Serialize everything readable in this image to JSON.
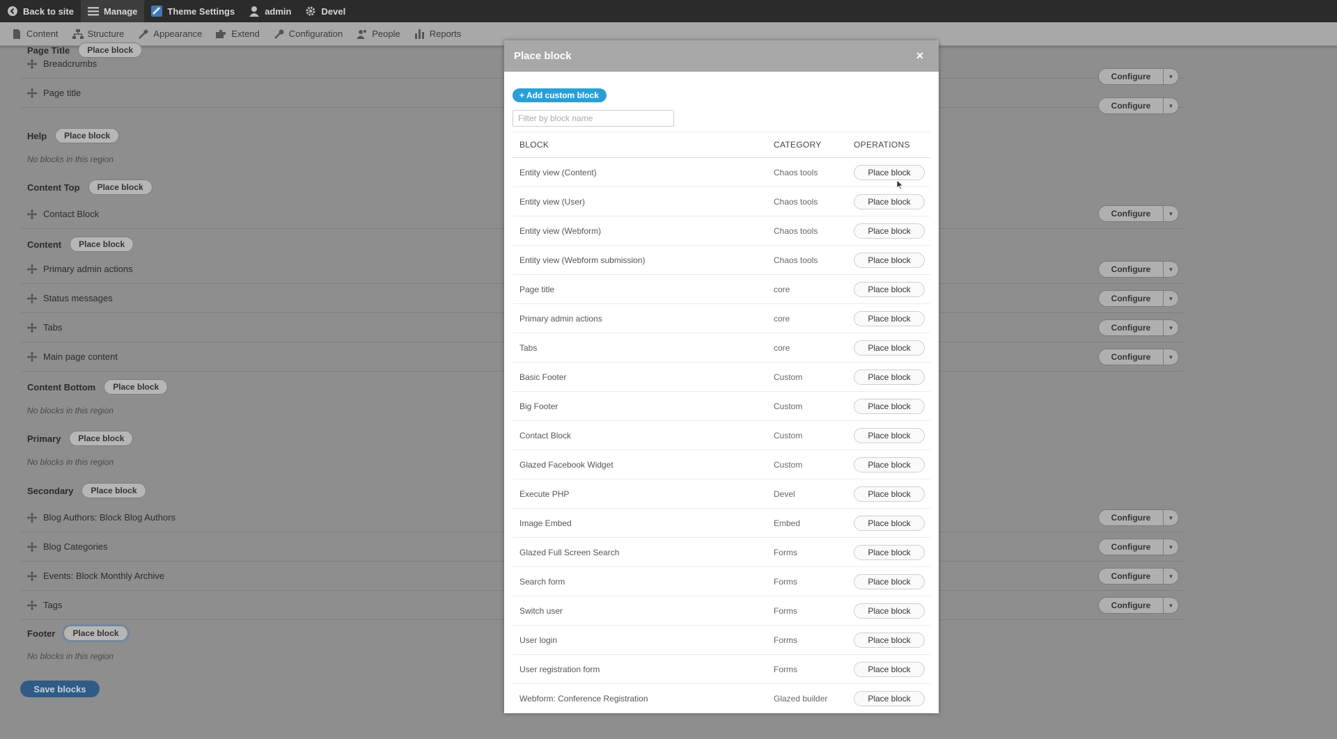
{
  "toolbar": {
    "back_label": "Back to site",
    "manage_label": "Manage",
    "theme_label": "Theme Settings",
    "user_label": "admin",
    "devel_label": "Devel"
  },
  "tray": [
    {
      "label": "Content",
      "icon": "content-icon"
    },
    {
      "label": "Structure",
      "icon": "structure-icon"
    },
    {
      "label": "Appearance",
      "icon": "appearance-icon"
    },
    {
      "label": "Extend",
      "icon": "extend-icon"
    },
    {
      "label": "Configuration",
      "icon": "configuration-icon"
    },
    {
      "label": "People",
      "icon": "people-icon"
    },
    {
      "label": "Reports",
      "icon": "reports-icon"
    }
  ],
  "regions": {
    "page_title": "Page Title",
    "help": "Help",
    "content_top": "Content Top",
    "content": "Content",
    "content_bottom": "Content Bottom",
    "primary": "Primary",
    "secondary": "Secondary",
    "footer": "Footer"
  },
  "place_block_label": "Place block",
  "configure_label": "Configure",
  "empty_label": "No blocks in this region",
  "save_label": "Save blocks",
  "blocks": {
    "breadcrumbs": "Breadcrumbs",
    "page_title": "Page title",
    "contact_block": "Contact Block",
    "primary_admin": "Primary admin actions",
    "status": "Status messages",
    "tabs": "Tabs",
    "main_content": "Main page content",
    "blog_authors": "Blog Authors: Block Blog Authors",
    "blog_categories": "Blog Categories",
    "events": "Events: Block Monthly Archive",
    "tags": "Tags"
  },
  "modal": {
    "title": "Place block",
    "close_glyph": "×",
    "add_custom_label": "+ Add custom block",
    "filter_placeholder": "Filter by block name",
    "headers": {
      "block": "BLOCK",
      "category": "CATEGORY",
      "operations": "OPERATIONS"
    },
    "rows": [
      {
        "block": "Entity view (Content)",
        "category": "Chaos tools"
      },
      {
        "block": "Entity view (User)",
        "category": "Chaos tools"
      },
      {
        "block": "Entity view (Webform)",
        "category": "Chaos tools"
      },
      {
        "block": "Entity view (Webform submission)",
        "category": "Chaos tools"
      },
      {
        "block": "Page title",
        "category": "core"
      },
      {
        "block": "Primary admin actions",
        "category": "core"
      },
      {
        "block": "Tabs",
        "category": "core"
      },
      {
        "block": "Basic Footer",
        "category": "Custom"
      },
      {
        "block": "Big Footer",
        "category": "Custom"
      },
      {
        "block": "Contact Block",
        "category": "Custom"
      },
      {
        "block": "Glazed Facebook Widget",
        "category": "Custom"
      },
      {
        "block": "Execute PHP",
        "category": "Devel"
      },
      {
        "block": "Image Embed",
        "category": "Embed"
      },
      {
        "block": "Glazed Full Screen Search",
        "category": "Forms"
      },
      {
        "block": "Search form",
        "category": "Forms"
      },
      {
        "block": "Switch user",
        "category": "Forms"
      },
      {
        "block": "User login",
        "category": "Forms"
      },
      {
        "block": "User registration form",
        "category": "Forms"
      },
      {
        "block": "Webform: Conference Registration",
        "category": "Glazed builder"
      }
    ]
  }
}
